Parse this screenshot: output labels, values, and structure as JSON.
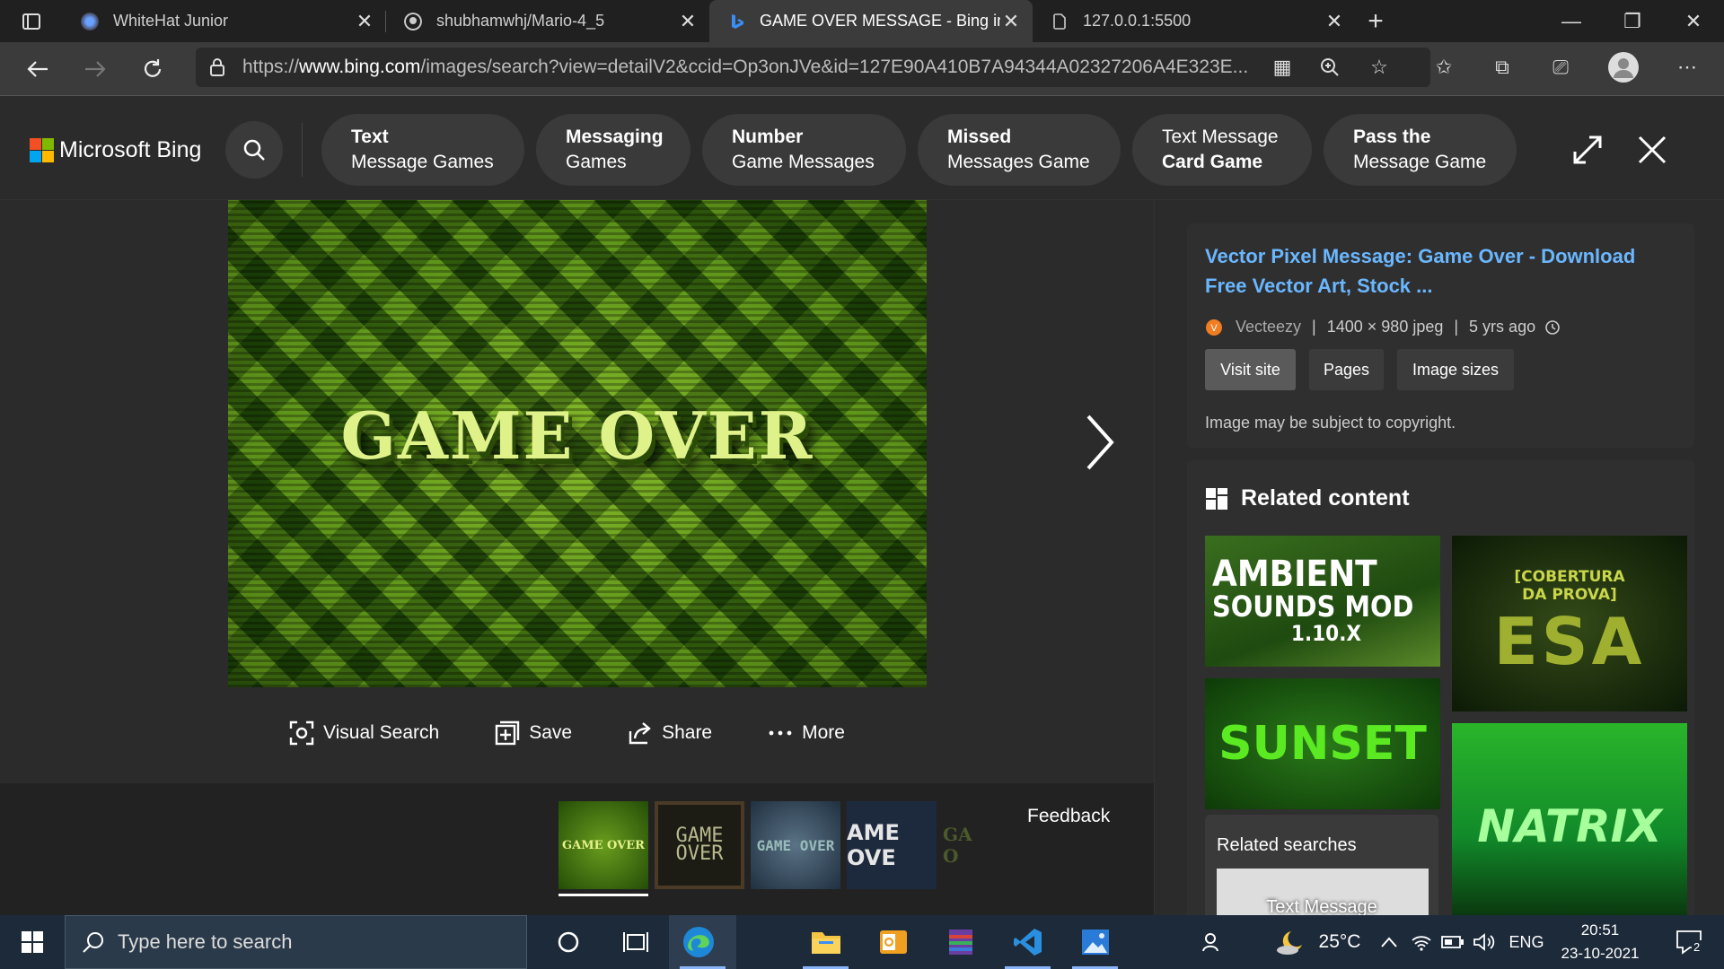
{
  "browser": {
    "tabs": [
      {
        "title": "WhiteHat Junior"
      },
      {
        "title": "shubhamwhj/Mario-4_5"
      },
      {
        "title": "GAME OVER MESSAGE - Bing images"
      },
      {
        "title": "127.0.0.1:5500"
      }
    ],
    "url_domain": "www.bing.com",
    "url_prefix": "https://",
    "url_rest": "/images/search?view=detailV2&ccid=Op3onJVe&id=127E90A410B7A94344A02327206A4E323E..."
  },
  "bing": {
    "logo_text": "Microsoft Bing",
    "pills": [
      {
        "line1": "Text",
        "line2": "Message Games",
        "bold": 1
      },
      {
        "line1": "Messaging",
        "line2": "Games",
        "bold": 1
      },
      {
        "line1": "Number",
        "line2": "Game Messages",
        "bold": 1
      },
      {
        "line1": "Missed",
        "line2": "Messages Game",
        "bold": 1
      },
      {
        "line1": "Text Message",
        "line2": "Card Game",
        "bold": 2
      },
      {
        "line1": "Pass the",
        "line2": "Message Game",
        "bold": 1
      }
    ]
  },
  "hero": {
    "title": "GAME OVER"
  },
  "actions": {
    "visual_search": "Visual Search",
    "save": "Save",
    "share": "Share",
    "more": "More"
  },
  "thumbs": [
    "GAME OVER",
    "GAME OVER",
    "GAME OVER",
    "AME OVE",
    "GA O"
  ],
  "feedback": "Feedback",
  "info": {
    "title": "Vector Pixel Message: Game Over - Download Free Vector Art, Stock ...",
    "source": "Vecteezy",
    "dims": "1400 × 980 jpeg",
    "age": "5 yrs ago",
    "visit": "Visit site",
    "pages": "Pages",
    "sizes": "Image sizes",
    "copyright": "Image may be subject to copyright."
  },
  "related": {
    "heading": "Related content",
    "images": [
      {
        "line1": "AMBIENT",
        "line2": "SOUNDS MOD",
        "line3": "1.10.X"
      },
      {
        "line1": "[COBERTURA",
        "line2": "DA PROVA]",
        "line3": "ESA"
      },
      {
        "line1": "SUNSET"
      },
      {
        "line1": "NATRIX"
      }
    ],
    "searches_label": "Related searches",
    "search_query": "Text Message"
  },
  "taskbar": {
    "search_placeholder": "Type here to search",
    "temp": "25°C",
    "lang": "ENG",
    "time": "20:51",
    "date": "23-10-2021",
    "notif": "2"
  },
  "colors": {
    "accent_link": "#6ab7ff",
    "bing_bg": "#2b2b2b"
  }
}
